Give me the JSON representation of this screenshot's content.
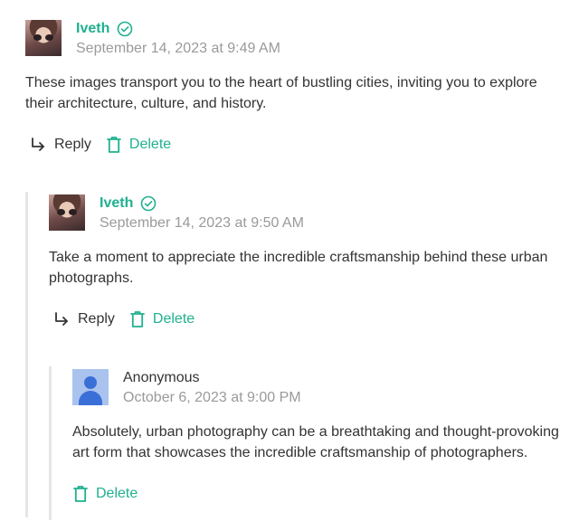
{
  "comments": [
    {
      "author": "Iveth",
      "verified": true,
      "date": "September 14, 2023 at 9:49 AM",
      "text": "These images transport you to the heart of bustling cities, inviting you to explore their architecture, culture, and history.",
      "reply_label": "Reply",
      "delete_label": "Delete"
    },
    {
      "author": "Iveth",
      "verified": true,
      "date": "September 14, 2023 at 9:50 AM",
      "text": "Take a moment to appreciate the incredible craftsmanship behind these urban photographs.",
      "reply_label": "Reply",
      "delete_label": "Delete"
    },
    {
      "author": "Anonymous",
      "verified": false,
      "date": "October 6, 2023 at 9:00 PM",
      "text": "Absolutely, urban photography can be a breathtaking and thought-provoking art form that showcases the incredible craftsmanship of photographers.",
      "delete_label": "Delete"
    }
  ],
  "colors": {
    "accent": "#1fb08f",
    "text": "#333333",
    "muted": "#9a9a9a",
    "thread_line": "#e6e6e6"
  },
  "icons": [
    "verified-check-icon",
    "reply-arrow-icon",
    "trash-icon",
    "anonymous-user-icon"
  ]
}
